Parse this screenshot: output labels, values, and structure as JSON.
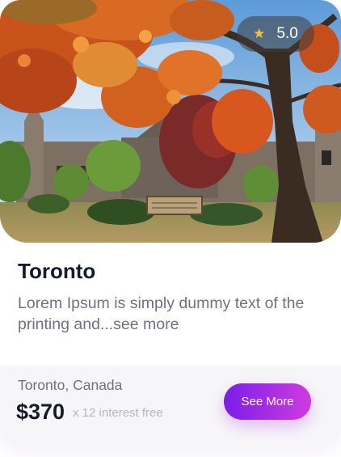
{
  "hero": {
    "image": "autumn-church-photo",
    "rating": {
      "icon": "star-icon",
      "value": "5.0",
      "star_color": "#f5c33b"
    }
  },
  "card": {
    "title": "Toronto",
    "description": "Lorem Ipsum is simply dummy text of the printing and...see more"
  },
  "footer": {
    "location": "Toronto, Canada",
    "price": "$370",
    "interest": "x 12 interest free",
    "button_label": "See More",
    "button_gradient": [
      "#7a1ee8",
      "#d03be0"
    ]
  }
}
